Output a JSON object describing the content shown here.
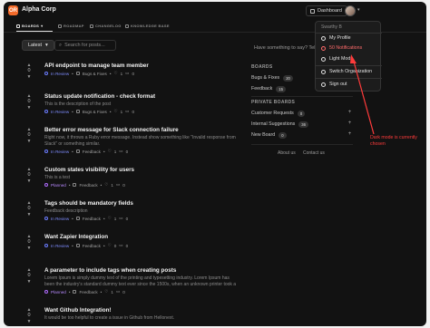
{
  "header": {
    "logo_text": "OR",
    "org_name": "Alpha Corp",
    "dashboard_label": "Dashboard"
  },
  "nav": {
    "items": [
      {
        "label": "BOARDS"
      },
      {
        "label": "ROADMAP"
      },
      {
        "label": "CHANGELOG"
      },
      {
        "label": "KNOWLEDGE BASE"
      }
    ]
  },
  "toolbar": {
    "sort_label": "Latest",
    "search_placeholder": "Search for posts..."
  },
  "posts": [
    {
      "votes": "0",
      "title": "API endpoint to manage team member",
      "desc": "",
      "status": "In Review",
      "board": "Bugs & Fixes",
      "likes": "1",
      "comments": "0"
    },
    {
      "votes": "0",
      "title": "Status update notification - check format",
      "desc": "This is the description of the post",
      "status": "In Review",
      "board": "Bugs & Fixes",
      "likes": "1",
      "comments": "0"
    },
    {
      "votes": "0",
      "title": "Better error message for Slack connection failure",
      "desc": "Right now, it throws a Ruby error message. Instead show something like \"Invalid response from Slack\" or something similar.",
      "status": "In Review",
      "board": "Feedback",
      "likes": "1",
      "comments": "0"
    },
    {
      "votes": "0",
      "title": "Custom states visibility for users",
      "desc": "This is a test",
      "status": "Planned",
      "board": "Feedback",
      "likes": "1",
      "comments": "0"
    },
    {
      "votes": "0",
      "title": "Tags should be mandatory fields",
      "desc": "Feedback description",
      "status": "In Review",
      "board": "Feedback",
      "likes": "1",
      "comments": "0"
    },
    {
      "votes": "0",
      "title": "Want Zapier Integration",
      "desc": "",
      "status": "In Review",
      "board": "Feedback",
      "likes": "0",
      "comments": "0"
    },
    {
      "votes": "0",
      "title": "A parameter to include tags when creating posts",
      "desc": "Lorem Ipsum is simply dummy text of the printing and typesetting industry. Lorem Ipsum has been the industry's standard dummy text ever since the 1500s, when an unknown printer took a",
      "status": "Planned",
      "board": "Feedback",
      "likes": "1",
      "comments": "0"
    },
    {
      "votes": "0",
      "title": "Want Github Integration!",
      "desc": "It would be too helpful to create a issue in Github from Hellonext.",
      "status": "",
      "board": "",
      "likes": "",
      "comments": ""
    }
  ],
  "sidebar": {
    "ask_text": "Have something to say? Tell us!",
    "boards_heading": "BOARDS",
    "boards": [
      {
        "label": "Bugs & Fixes",
        "count": "20"
      },
      {
        "label": "Feedback",
        "count": "15"
      }
    ],
    "private_heading": "PRIVATE BOARDS",
    "private_boards": [
      {
        "label": "Customer Requests",
        "count": "0"
      },
      {
        "label": "Internal Suggestions",
        "count": "36"
      },
      {
        "label": "New Board",
        "count": "0"
      }
    ],
    "footer_about": "About us",
    "footer_contact": "Contact us"
  },
  "dropdown": {
    "user_name": "Swarthy B",
    "items": [
      {
        "label": "My Profile"
      },
      {
        "label": "50 Notifications"
      },
      {
        "label": "Light Mode"
      },
      {
        "label": "Switch Organization"
      },
      {
        "label": "Sign out"
      }
    ]
  },
  "annotation": {
    "text": "Dark mode is currently chosen",
    "color": "#ff3b3b"
  }
}
